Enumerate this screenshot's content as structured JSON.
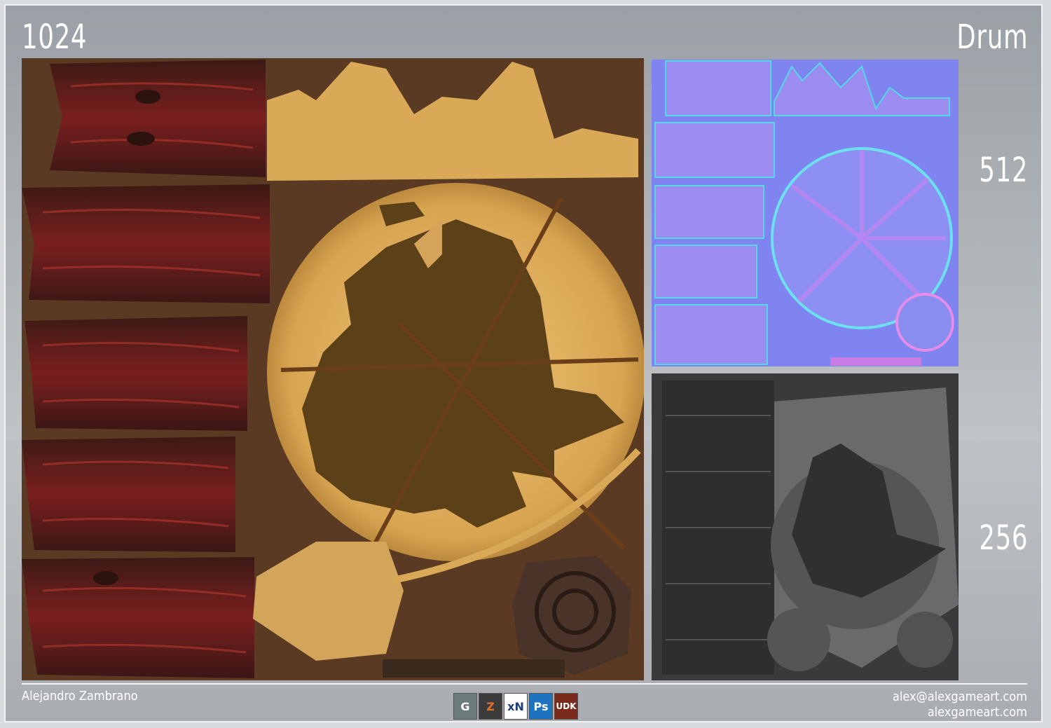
{
  "header": {
    "resolution_label": "1024",
    "asset_name": "Drum"
  },
  "side_labels": {
    "label_512": "512",
    "label_256": "256"
  },
  "footer": {
    "author": "Alejandro Zambrano",
    "email": "alex@alexgameart.com",
    "website": "alexgameart.com",
    "software_logos": [
      {
        "name": "3ds-max-logo",
        "text": "G",
        "color": "#6b7b7c"
      },
      {
        "name": "zbrush-logo",
        "text": "Z",
        "color": "#3b3b3b"
      },
      {
        "name": "xnormal-logo",
        "text": "xN",
        "color": "#ffffff"
      },
      {
        "name": "photoshop-logo",
        "text": "Ps",
        "color": "#1e73be"
      },
      {
        "name": "udk-logo",
        "text": "UDK",
        "color": "#7a2a1a"
      }
    ]
  },
  "colors": {
    "diffuse_background": "#5a3a22",
    "normal_background": "#7f84f0",
    "spec_background": "#3a3a3a",
    "wood": "#6e1e1e",
    "leather": "#d7a451"
  }
}
